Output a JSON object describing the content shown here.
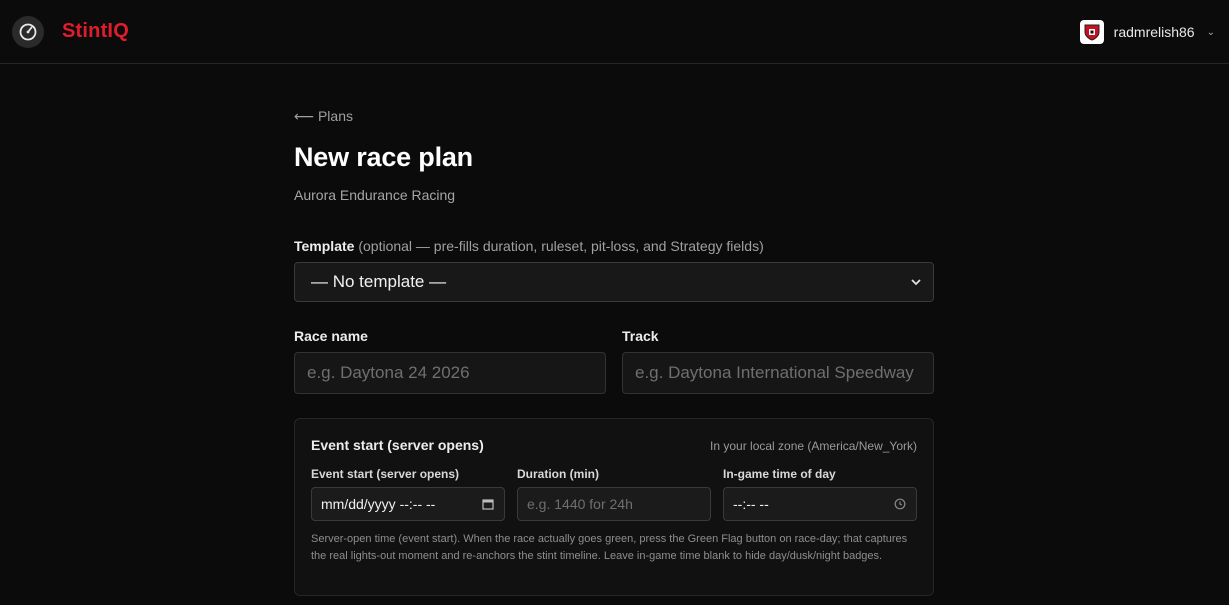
{
  "app": {
    "brand": "StintIQ"
  },
  "user": {
    "name": "radmrelish86"
  },
  "nav": {
    "back_label": "⟵ Plans"
  },
  "page": {
    "title": "New race plan",
    "subtitle": "Aurora Endurance Racing"
  },
  "template": {
    "label": "Template",
    "hint": "(optional — pre-fills duration, ruleset, pit-loss, and Strategy fields)",
    "selected": "— No template —"
  },
  "race_name": {
    "label": "Race name",
    "placeholder": "e.g. Daytona 24 2026"
  },
  "track": {
    "label": "Track",
    "placeholder": "e.g. Daytona International Speedway"
  },
  "event_panel": {
    "title": "Event start (server opens)",
    "zone_note": "In your local zone (America/New_York)",
    "event_start": {
      "label": "Event start (server opens)",
      "value": "mm/dd/yyyy --:-- --"
    },
    "duration": {
      "label": "Duration (min)",
      "placeholder": "e.g. 1440 for 24h"
    },
    "time_of_day": {
      "label": "In-game time of day",
      "value": "--:-- --"
    },
    "help": "Server-open time (event start). When the race actually goes green, press the Green Flag button on race-day; that captures the real lights-out moment and re-anchors the stint timeline. Leave in-game time blank to hide day/dusk/night badges."
  },
  "colors": {
    "brand": "#e11d2a",
    "background": "#0b0b0b",
    "panel": "#111111"
  }
}
